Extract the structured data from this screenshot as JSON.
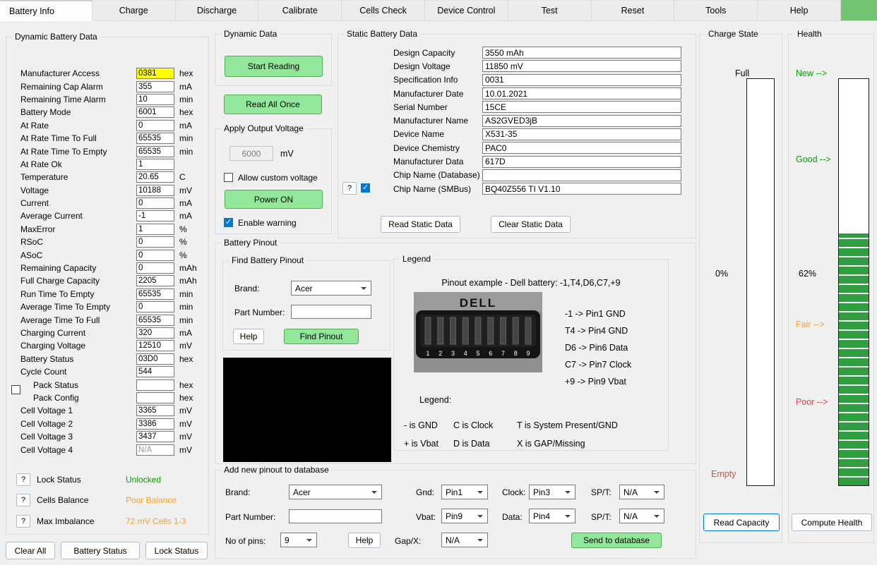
{
  "tab_bar": {
    "tabs": [
      "Battery Info",
      "Charge",
      "Discharge",
      "Calibrate",
      "Cells Check",
      "Device Control",
      "Test",
      "Reset",
      "Tools",
      "Help"
    ],
    "active_tab": "Battery Info"
  },
  "dynamic_battery_data": {
    "title": "Dynamic Battery Data",
    "rows": [
      {
        "label": "Manufacturer Access",
        "value": "0381",
        "unit": "hex",
        "highlight": true
      },
      {
        "label": "Remaining Cap Alarm",
        "value": "355",
        "unit": "mA"
      },
      {
        "label": "Remaining Time Alarm",
        "value": "10",
        "unit": "min"
      },
      {
        "label": "Battery Mode",
        "value": "6001",
        "unit": "hex"
      },
      {
        "label": "At Rate",
        "value": "0",
        "unit": "mA"
      },
      {
        "label": "At Rate Time To Full",
        "value": "65535",
        "unit": "min"
      },
      {
        "label": "At Rate Time To Empty",
        "value": "65535",
        "unit": "min"
      },
      {
        "label": "At Rate Ok",
        "value": "1",
        "unit": ""
      },
      {
        "label": "Temperature",
        "value": "20.65",
        "unit": "C"
      },
      {
        "label": "Voltage",
        "value": "10188",
        "unit": "mV"
      },
      {
        "label": "Current",
        "value": "0",
        "unit": "mA"
      },
      {
        "label": "Average Current",
        "value": "-1",
        "unit": "mA"
      },
      {
        "label": "MaxError",
        "value": "1",
        "unit": "%"
      },
      {
        "label": "RSoC",
        "value": "0",
        "unit": "%"
      },
      {
        "label": "ASoC",
        "value": "0",
        "unit": "%"
      },
      {
        "label": "Remaining Capacity",
        "value": "0",
        "unit": "mAh"
      },
      {
        "label": "Full Charge Capacity",
        "value": "2205",
        "unit": "mAh"
      },
      {
        "label": "Run Time To Empty",
        "value": "65535",
        "unit": "min"
      },
      {
        "label": "Average Time To Empty",
        "value": "0",
        "unit": "min"
      },
      {
        "label": "Average Time To Full",
        "value": "65535",
        "unit": "min"
      },
      {
        "label": "Charging Current",
        "value": "320",
        "unit": "mA"
      },
      {
        "label": "Charging Voltage",
        "value": "12510",
        "unit": "mV"
      },
      {
        "label": "Battery Status",
        "value": "03D0",
        "unit": "hex"
      },
      {
        "label": "Cycle Count",
        "value": "544",
        "unit": ""
      },
      {
        "label": "Pack Status",
        "value": "",
        "unit": "hex",
        "checkbox": true,
        "indent": true
      },
      {
        "label": "Pack Config",
        "value": "",
        "unit": "hex",
        "indent": true
      },
      {
        "label": "Cell Voltage 1",
        "value": "3365",
        "unit": "mV"
      },
      {
        "label": "Cell Voltage 2",
        "value": "3386",
        "unit": "mV"
      },
      {
        "label": "Cell Voltage 3",
        "value": "3437",
        "unit": "mV"
      },
      {
        "label": "Cell Voltage 4",
        "value": "N/A",
        "unit": "mV",
        "disabled": true
      }
    ],
    "status_rows": [
      {
        "help": "?",
        "label": "Lock Status",
        "value": "Unlocked",
        "color": "#00a000"
      },
      {
        "help": "?",
        "label": "Cells Balance",
        "value": "Poor Balance",
        "color": "#ffa01e"
      },
      {
        "help": "?",
        "label": "Max Imbalance",
        "value": "72 mV Cells 1-3",
        "color": "#ffa01e"
      }
    ],
    "footer_buttons": [
      "Clear All",
      "Battery Status",
      "Lock Status"
    ]
  },
  "dynamic_data": {
    "title": "Dynamic Data",
    "start_reading": "Start Reading",
    "read_all_once": "Read All Once"
  },
  "apply_output_voltage": {
    "title": "Apply Output Voltage",
    "voltage_value": "6000",
    "voltage_unit": "mV",
    "allow_custom_label": "Allow custom voltage",
    "power_on": "Power ON",
    "enable_warning_label": "Enable warning"
  },
  "static_battery_data": {
    "title": "Static Battery Data",
    "rows": [
      {
        "label": "Design Capacity",
        "value": "3550 mAh"
      },
      {
        "label": "Design Voltage",
        "value": "11850 mV"
      },
      {
        "label": "Specification Info",
        "value": "0031"
      },
      {
        "label": "Manufacturer Date",
        "value": "10.01.2021"
      },
      {
        "label": "Serial Number",
        "value": "15CE"
      },
      {
        "label": "Manufacturer Name",
        "value": "AS2GVED3jB"
      },
      {
        "label": "Device Name",
        "value": "X531-35"
      },
      {
        "label": "Device Chemistry",
        "value": "PAC0"
      },
      {
        "label": "Manufacturer Data",
        "value": "617D"
      },
      {
        "label": "Chip Name (Database)",
        "value": ""
      },
      {
        "label": "Chip Name (SMBus)",
        "value": "BQ40Z556 TI V1.10",
        "help": "?",
        "checkbox": true
      }
    ],
    "read_button": "Read Static Data",
    "clear_button": "Clear Static Data"
  },
  "battery_pinout": {
    "title": "Battery Pinout",
    "find": {
      "title": "Find Battery Pinout",
      "brand_label": "Brand:",
      "brand_value": "Acer",
      "part_label": "Part Number:",
      "part_value": "",
      "help_button": "Help",
      "find_button": "Find Pinout"
    },
    "legend": {
      "title": "Legend",
      "example": "Pinout example - Dell battery:  -1,T4,D6,C7,+9",
      "connector_brand": "DELL",
      "pin_numbers": [
        "1",
        "2",
        "3",
        "4",
        "5",
        "6",
        "7",
        "8",
        "9"
      ],
      "mappings": [
        "-1 -> Pin1 GND",
        "T4 -> Pin4 GND",
        "D6 -> Pin6 Data",
        "C7 -> Pin7 Clock",
        "+9 -> Pin9 Vbat"
      ],
      "legend_label": "Legend:",
      "legend_rows": [
        [
          "- is GND",
          "C is Clock",
          "T is System Present/GND"
        ],
        [
          "+ is Vbat",
          "D is Data",
          "X is GAP/Missing"
        ]
      ]
    }
  },
  "add_pinout": {
    "title": "Add new pinout to database",
    "brand_label": "Brand:",
    "brand_value": "Acer",
    "part_label": "Part Number:",
    "part_value": "",
    "pins_label": "No of pins:",
    "pins_value": "9",
    "help_button": "Help",
    "gnd_label": "Gnd:",
    "gnd_value": "Pin1",
    "clock_label": "Clock:",
    "clock_value": "Pin3",
    "spt1_label": "SP/T:",
    "spt1_value": "N/A",
    "vbat_label": "Vbat:",
    "vbat_value": "Pin9",
    "data_label": "Data:",
    "data_value": "Pin4",
    "spt2_label": "SP/T:",
    "spt2_value": "N/A",
    "gap_label": "Gap/X:",
    "gap_value": "N/A",
    "send_button": "Send to database"
  },
  "charge_state": {
    "title": "Charge State",
    "full_label": "Full",
    "percent": "0%",
    "empty_label": "Empty",
    "button": "Read Capacity",
    "fill_percent": 0
  },
  "health": {
    "title": "Health",
    "new_label": "New -->",
    "good_label": "Good -->",
    "percent": "62%",
    "fair_label": "Fair -->",
    "poor_label": "Poor -->",
    "button": "Compute Health",
    "fill_percent": 62
  },
  "colors": {
    "green_button": "#93e79b",
    "checked_blue": "#0078d7",
    "highlight_yellow": "#ffff00",
    "health_fill": "#2f9e41",
    "status_green": "#00a000",
    "status_orange": "#ffa01e",
    "fair_orange": "#ffa01e",
    "poor_red": "#e04040",
    "empty_red": "#c05a4a",
    "tab_indicator_green": "#72c472"
  }
}
